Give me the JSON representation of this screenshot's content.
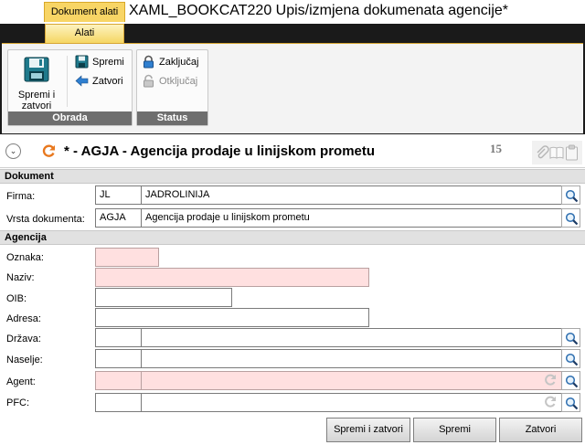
{
  "window": {
    "context_tab": "Dokument alati",
    "title": "XAML_BOOKCAT220  Upis/izmjena dokumenata agencije*"
  },
  "ribbon": {
    "tab": "Alati",
    "obrada": {
      "label": "Obrada",
      "save_close": "Spremi i zatvori",
      "save": "Spremi",
      "close": "Zatvori"
    },
    "status": {
      "label": "Status",
      "lock": "Zaključaj",
      "unlock": "Otključaj"
    }
  },
  "header": {
    "text": "* - AGJA - Agencija prodaje u linijskom prometu",
    "counter": "15"
  },
  "sections": {
    "dokument": "Dokument",
    "agencija": "Agencija"
  },
  "dokument": {
    "firma": {
      "label": "Firma:",
      "code": "JL",
      "name": "JADROLINIJA"
    },
    "vrsta": {
      "label": "Vrsta dokumenta:",
      "code": "AGJA",
      "name": "Agencija prodaje u linijskom prometu"
    }
  },
  "agencija": {
    "oznaka": {
      "label": "Oznaka:",
      "value": ""
    },
    "naziv": {
      "label": "Naziv:",
      "value": ""
    },
    "oib": {
      "label": "OIB:",
      "value": ""
    },
    "adresa": {
      "label": "Adresa:",
      "value": ""
    },
    "drzava": {
      "label": "Država:",
      "code": "",
      "name": ""
    },
    "naselje": {
      "label": "Naselje:",
      "code": "",
      "name": ""
    },
    "agent": {
      "label": "Agent:",
      "code": "",
      "name": ""
    },
    "pfc": {
      "label": "PFC:",
      "code": "",
      "name": ""
    }
  },
  "footer": {
    "save_close": "Spremi i zatvori",
    "save": "Spremi",
    "close": "Zatvori"
  },
  "colors": {
    "required_bg": "#ffe0e0",
    "ribbon_accent": "#f5d663",
    "refresh_icon": "#e8781e"
  }
}
